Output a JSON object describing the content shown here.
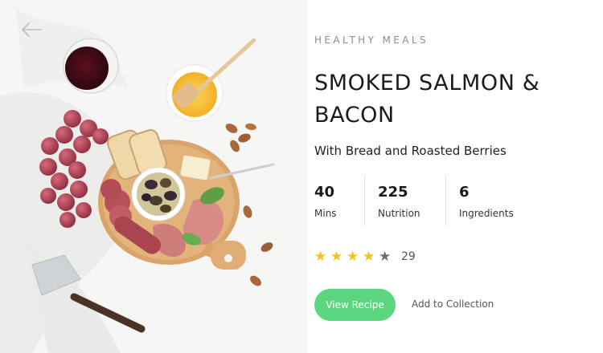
{
  "category": "HEALTHY MEALS",
  "title": "SMOKED SALMON & BACON",
  "subtitle": "With Bread and Roasted Berries",
  "stats": [
    {
      "value": "40",
      "label": "Mins"
    },
    {
      "value": "225",
      "label": "Nutrition"
    },
    {
      "value": "6",
      "label": "Ingredients"
    }
  ],
  "rating": {
    "stars": 4,
    "max": 5,
    "count": "29"
  },
  "actions": {
    "primary": "View Recipe",
    "secondary": "Add to Collection"
  },
  "colors": {
    "accent": "#5cd67e",
    "star": "#f8c21b",
    "star_empty": "#6b6b6b"
  },
  "icons": {
    "back": "back-arrow-icon",
    "star": "star-icon"
  }
}
